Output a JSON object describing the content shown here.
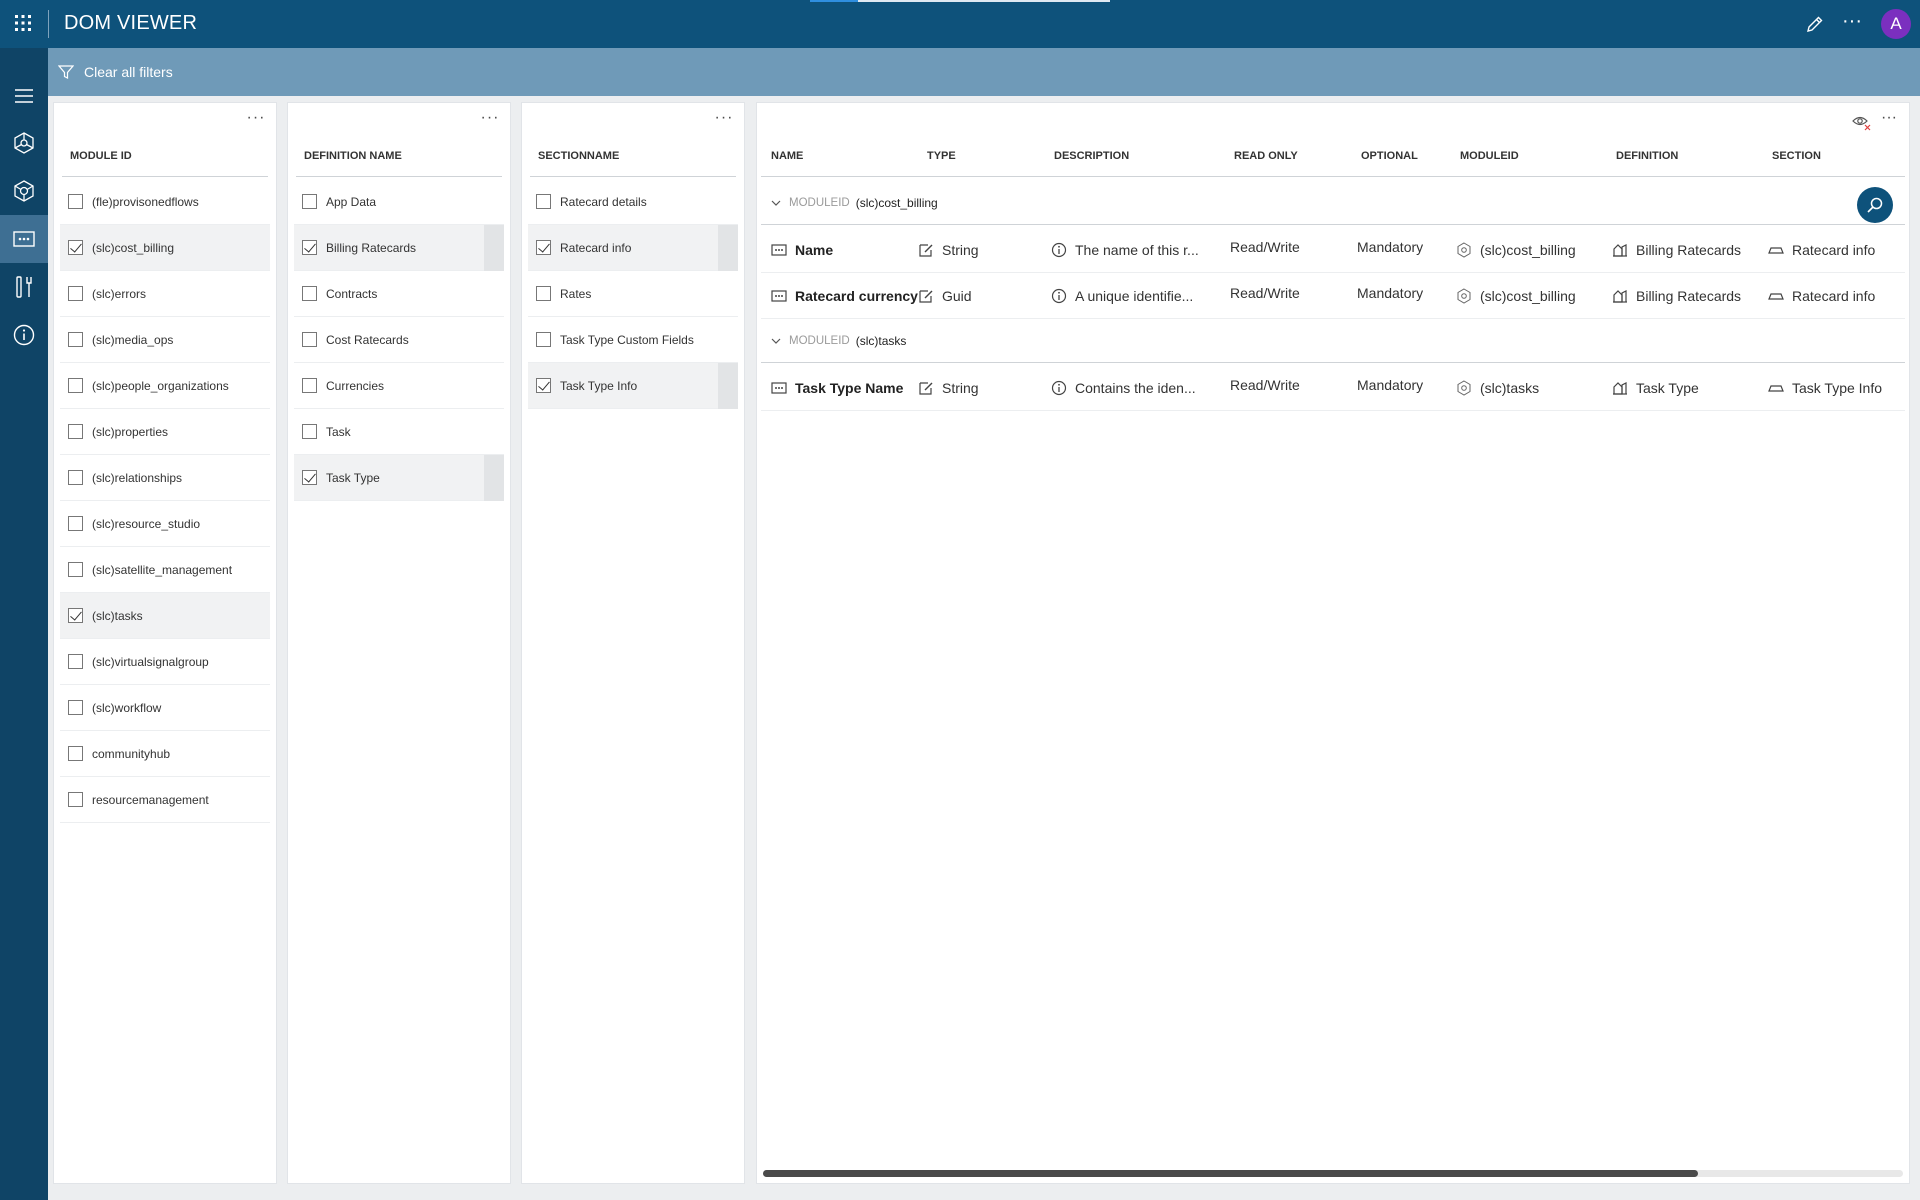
{
  "header": {
    "title": "DOM VIEWER",
    "avatar_initial": "A",
    "loading_progress": 0.16
  },
  "filterbar": {
    "clear_label": "Clear all filters"
  },
  "nav": {
    "items": [
      "hub-icon",
      "module-icon",
      "dom-viewer-icon",
      "tools-icon",
      "info-icon"
    ],
    "active": "dom-viewer-icon"
  },
  "module_panel": {
    "header": "MODULE ID",
    "items": [
      {
        "label": "(fle)provisonedflows",
        "checked": false
      },
      {
        "label": "(slc)cost_billing",
        "checked": true
      },
      {
        "label": "(slc)errors",
        "checked": false
      },
      {
        "label": "(slc)media_ops",
        "checked": false
      },
      {
        "label": "(slc)people_organizations",
        "checked": false
      },
      {
        "label": "(slc)properties",
        "checked": false
      },
      {
        "label": "(slc)relationships",
        "checked": false
      },
      {
        "label": "(slc)resource_studio",
        "checked": false
      },
      {
        "label": "(slc)satellite_management",
        "checked": false
      },
      {
        "label": "(slc)tasks",
        "checked": true
      },
      {
        "label": "(slc)virtualsignalgroup",
        "checked": false
      },
      {
        "label": "(slc)workflow",
        "checked": false
      },
      {
        "label": "communityhub",
        "checked": false
      },
      {
        "label": "resourcemanagement",
        "checked": false
      }
    ]
  },
  "definition_panel": {
    "header": "DEFINITION NAME",
    "items": [
      {
        "label": "App Data",
        "checked": false
      },
      {
        "label": "Billing Ratecards",
        "checked": true
      },
      {
        "label": "Contracts",
        "checked": false
      },
      {
        "label": "Cost Ratecards",
        "checked": false
      },
      {
        "label": "Currencies",
        "checked": false
      },
      {
        "label": "Task",
        "checked": false
      },
      {
        "label": "Task Type",
        "checked": true
      }
    ]
  },
  "section_panel": {
    "header": "SECTIONNAME",
    "items": [
      {
        "label": "Ratecard details",
        "checked": false
      },
      {
        "label": "Ratecard info",
        "checked": true
      },
      {
        "label": "Rates",
        "checked": false
      },
      {
        "label": "Task Type Custom Fields",
        "checked": false
      },
      {
        "label": "Task Type Info",
        "checked": true
      }
    ]
  },
  "table": {
    "columns": {
      "name": "NAME",
      "type": "TYPE",
      "description": "DESCRIPTION",
      "read_only": "READ ONLY",
      "optional": "OPTIONAL",
      "moduleid": "MODULEID",
      "definition": "DEFINITION",
      "section": "SECTION"
    },
    "groups": [
      {
        "label": "MODULEID",
        "value": "(slc)cost_billing",
        "rows": [
          {
            "name": "Name",
            "type": "String",
            "description": "The name of this r...",
            "read_only": "Read/Write",
            "optional": "Mandatory",
            "moduleid": "(slc)cost_billing",
            "definition": "Billing Ratecards",
            "section": "Ratecard info"
          },
          {
            "name": "Ratecard currency",
            "type": "Guid",
            "description": "A unique identifie...",
            "read_only": "Read/Write",
            "optional": "Mandatory",
            "moduleid": "(slc)cost_billing",
            "definition": "Billing Ratecards",
            "section": "Ratecard info"
          }
        ]
      },
      {
        "label": "MODULEID",
        "value": "(slc)tasks",
        "rows": [
          {
            "name": "Task Type Name",
            "type": "String",
            "description": "Contains the iden...",
            "read_only": "Read/Write",
            "optional": "Mandatory",
            "moduleid": "(slc)tasks",
            "definition": "Task Type",
            "section": "Task Type Info"
          }
        ]
      }
    ],
    "scroll_thumb_fraction": 0.82
  },
  "colors": {
    "header_bg": "#0e527b",
    "nav_bg": "#0f4466",
    "nav_active": "#3e6f93",
    "filterbar_bg": "#6f9ab8",
    "avatar_bg": "#7b2fbf"
  }
}
